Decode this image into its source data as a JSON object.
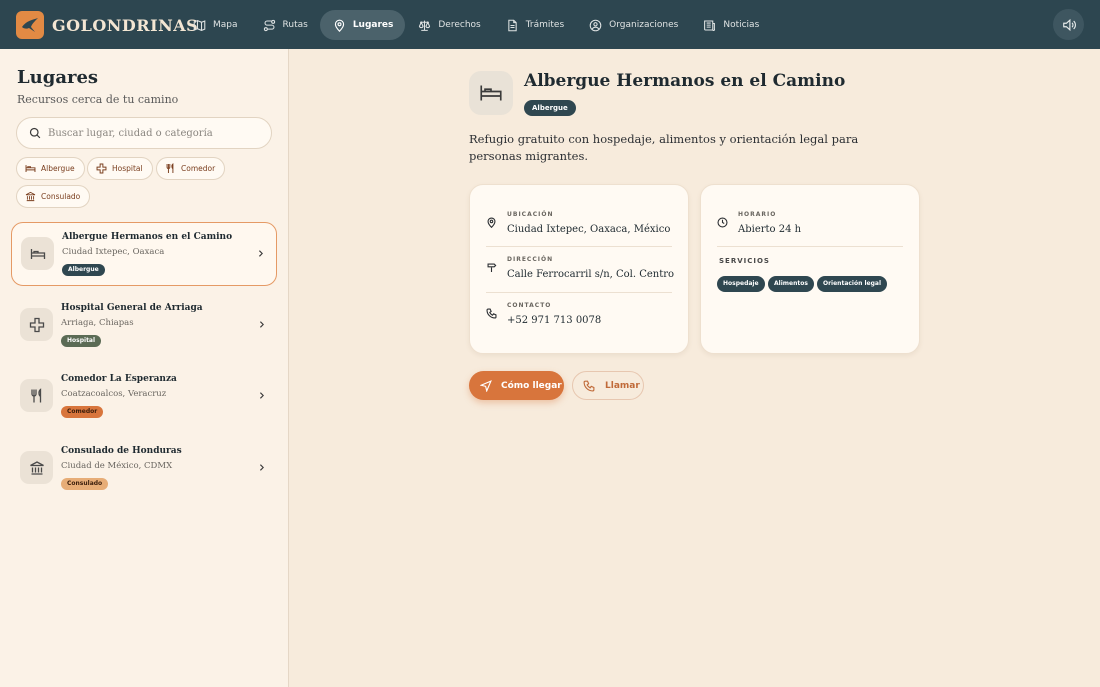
{
  "brand": {
    "name": "GOLONDRINAS"
  },
  "nav": [
    {
      "label": "Mapa",
      "icon": "map-icon"
    },
    {
      "label": "Rutas",
      "icon": "route-icon"
    },
    {
      "label": "Lugares",
      "icon": "map-pin-icon",
      "active": true
    },
    {
      "label": "Derechos",
      "icon": "scale-icon"
    },
    {
      "label": "Trámites",
      "icon": "document-icon"
    },
    {
      "label": "Organizaciones",
      "icon": "organization-icon"
    },
    {
      "label": "Noticias",
      "icon": "newspaper-icon"
    }
  ],
  "sidebar": {
    "title": "Lugares",
    "subtitle": "Recursos cerca de tu camino",
    "search_placeholder": "Buscar lugar, ciudad o categoría",
    "filters": [
      "Albergue",
      "Hospital",
      "Comedor",
      "Consulado"
    ],
    "places": [
      {
        "name": "Albergue Hermanos en el Camino",
        "city": "Ciudad Ixtepec, Oaxaca",
        "tag": "Albergue",
        "tag_color": "#2f4750",
        "icon": "bed-icon",
        "selected": true
      },
      {
        "name": "Hospital General de Arriaga",
        "city": "Arriaga, Chiapas",
        "tag": "Hospital",
        "tag_color": "#5b6b55",
        "icon": "hospital-cross-icon"
      },
      {
        "name": "Comedor La Esperanza",
        "city": "Coatzacoalcos, Veracruz",
        "tag": "Comedor",
        "tag_color": "#d8753c",
        "icon": "utensils-icon"
      },
      {
        "name": "Consulado de Honduras",
        "city": "Ciudad de México, CDMX",
        "tag": "Consulado",
        "tag_color": "#e7ad77",
        "icon": "consulate-icon"
      }
    ]
  },
  "detail": {
    "title": "Albergue Hermanos en el Camino",
    "tag": "Albergue",
    "description": "Refugio gratuito con hospedaje, alimentos y orientación legal para personas migrantes.",
    "location_label": "UBICACIÓN",
    "location": "Ciudad Ixtepec, Oaxaca, México",
    "address_label": "DIRECCIÓN",
    "address": "Calle Ferrocarril s/n, Col. Centro",
    "contact_label": "CONTACTO",
    "contact": "+52 971 713 0078",
    "hours_label": "HORARIO",
    "hours": "Abierto 24 h",
    "services_label": "SERVICIOS",
    "services": [
      "Hospedaje",
      "Alimentos",
      "Orientación legal"
    ],
    "directions_label": "Cómo llegar",
    "call_label": "Llamar"
  },
  "colors": {
    "topbar": "#2d4650",
    "accent": "#d8753c",
    "tag_dark": "#2f4750"
  }
}
